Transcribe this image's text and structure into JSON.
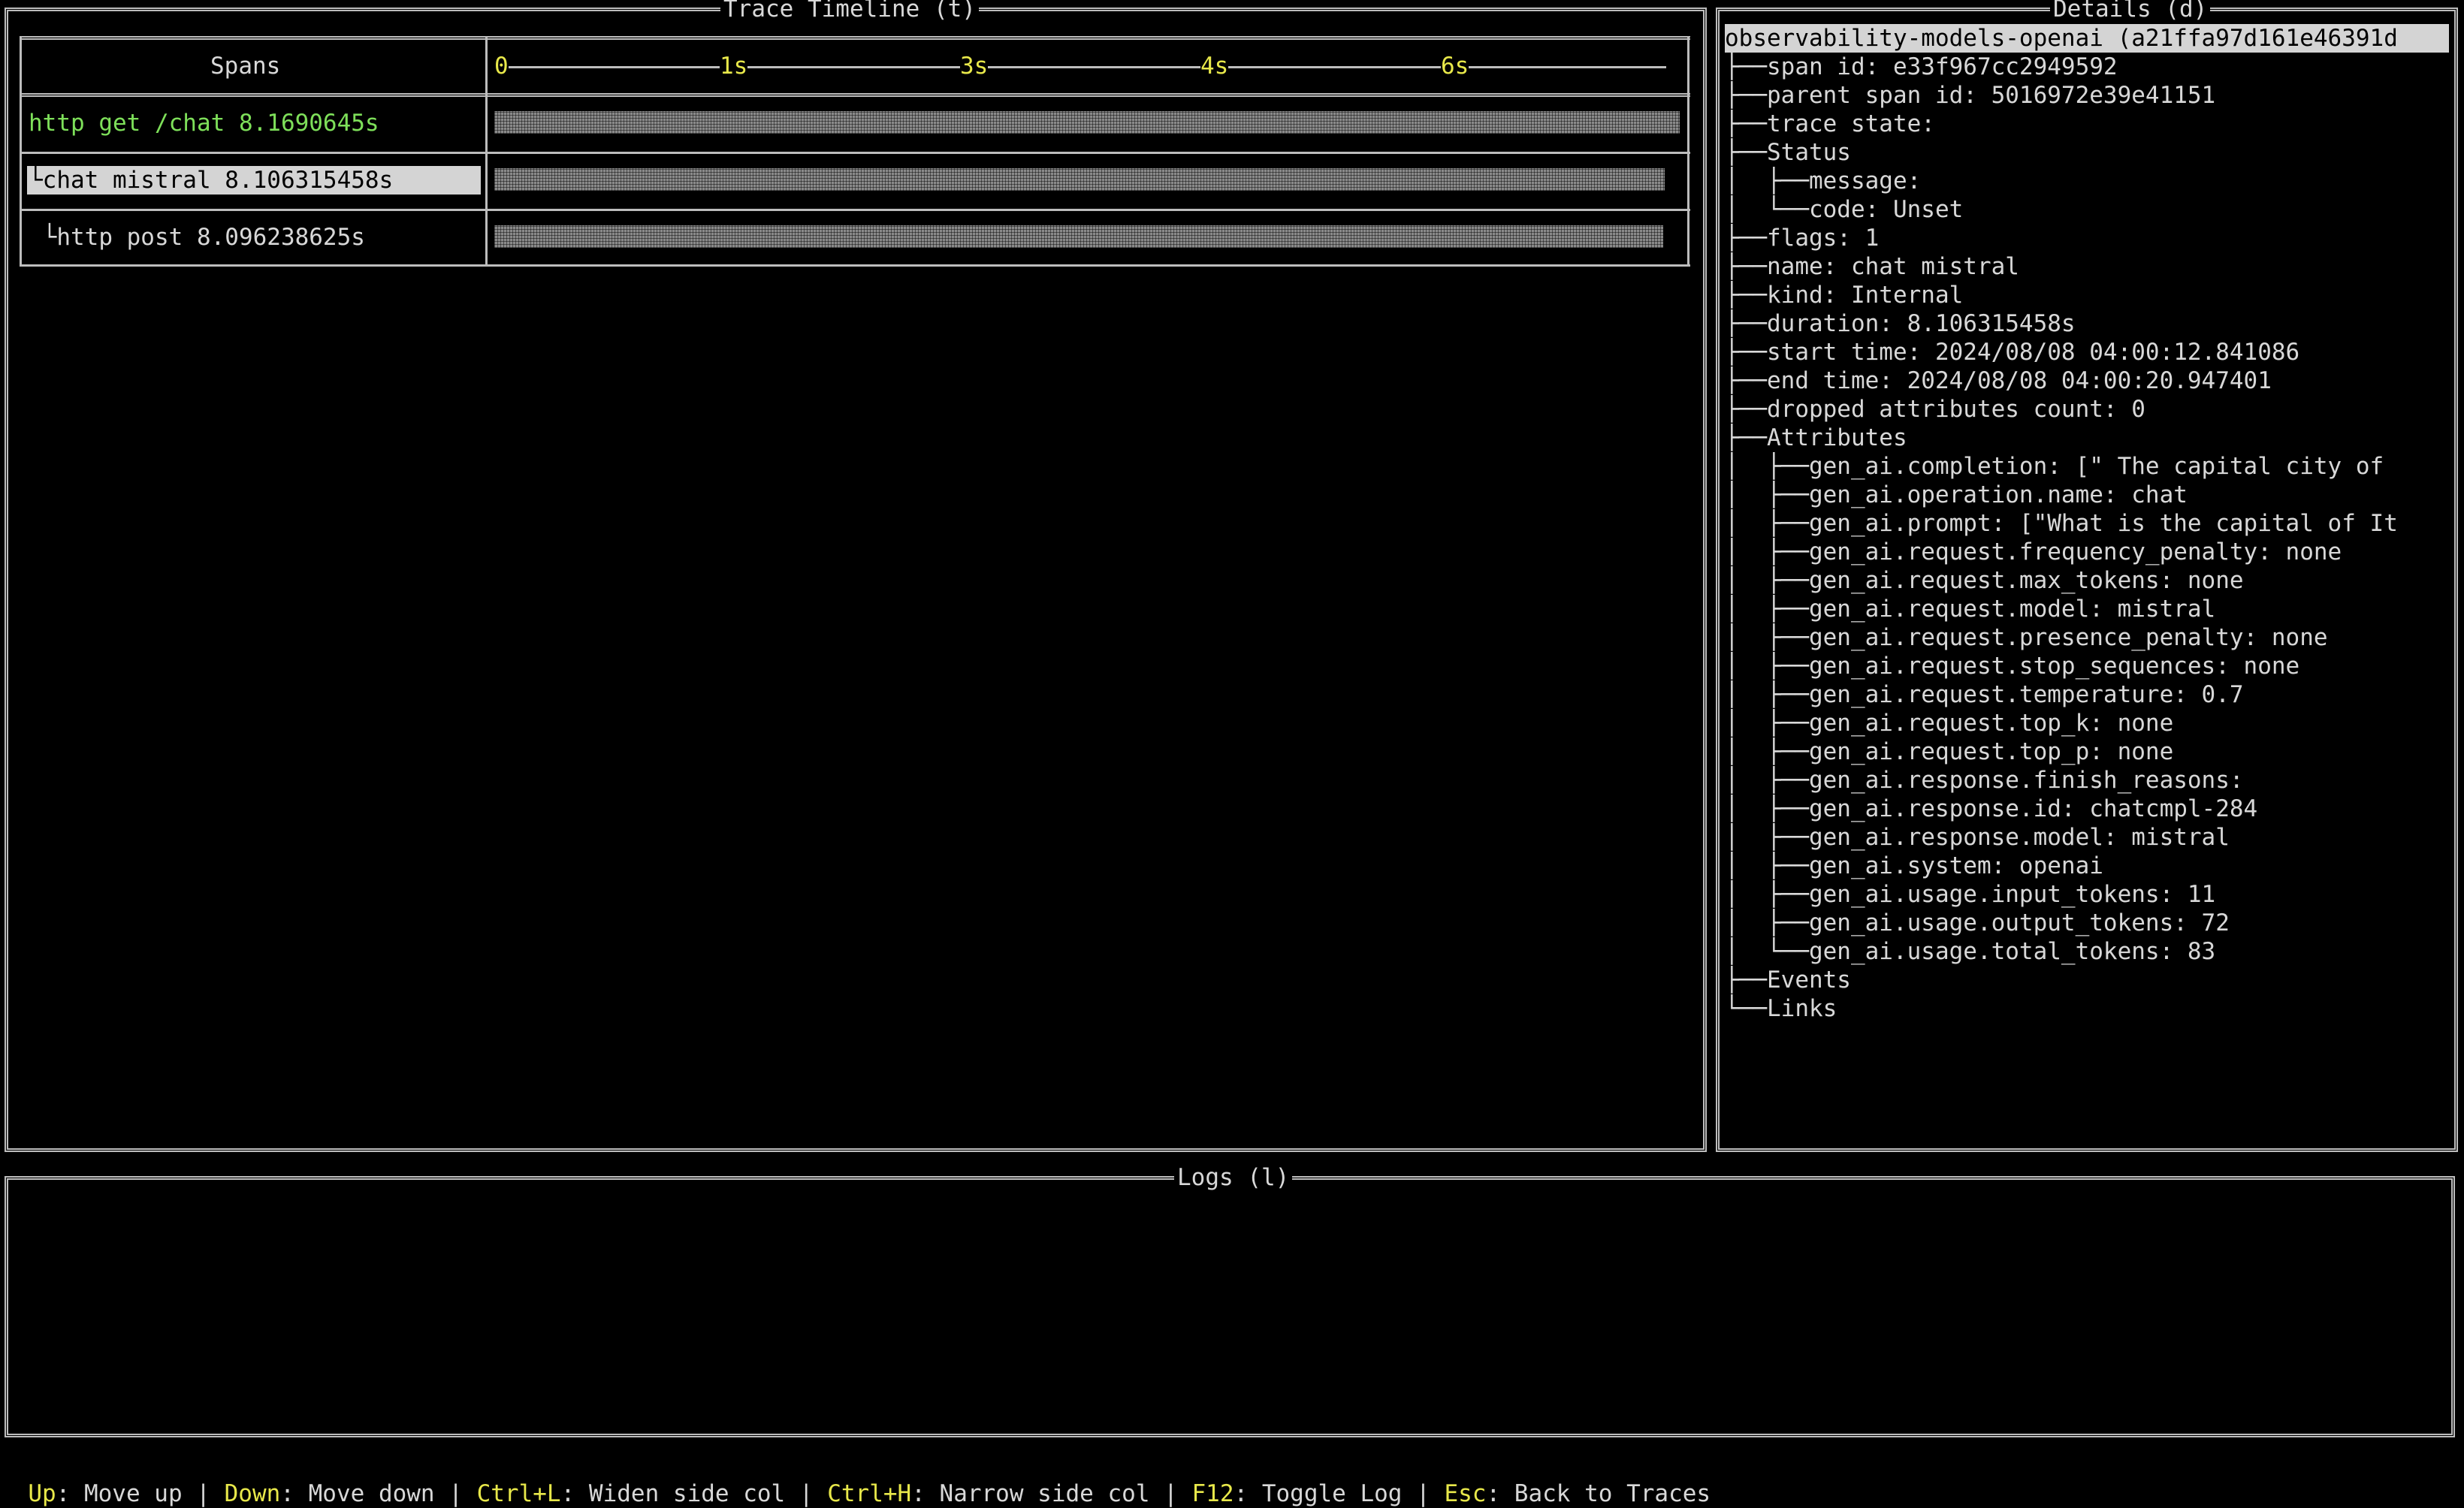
{
  "timeline": {
    "title": "Trace Timeline (t)",
    "spans_header": "Spans",
    "ticks": [
      "0",
      "1s",
      "3s",
      "4s",
      "6s"
    ],
    "spans": [
      {
        "label": "http get /chat 8.1690645s",
        "color": "#7ee05a",
        "selected": false,
        "start": 0.0,
        "duration": 8.1690645
      },
      {
        "label": "└chat mistral 8.106315458s",
        "color": "#000000",
        "selected": true,
        "start": 0.0,
        "duration": 8.106315458
      },
      {
        "label": " └http post 8.096238625s",
        "color": "#d8d8d8",
        "selected": false,
        "start": 0.0,
        "duration": 8.096238625
      }
    ]
  },
  "details": {
    "title": "Details (d)",
    "header": "observability-models-openai (a21ffa97d161e46391d",
    "lines": [
      "├──span id: e33f967cc2949592",
      "├──parent span id: 5016972e39e41151",
      "├──trace state:",
      "├──Status",
      "│  ├──message:",
      "│  └──code: Unset",
      "├──flags: 1",
      "├──name: chat mistral",
      "├──kind: Internal",
      "├──duration: 8.106315458s",
      "├──start time: 2024/08/08 04:00:12.841086",
      "├──end time: 2024/08/08 04:00:20.947401",
      "├──dropped attributes count: 0",
      "├──Attributes",
      "│  ├──gen_ai.completion: [\" The capital city of",
      "│  ├──gen_ai.operation.name: chat",
      "│  ├──gen_ai.prompt: [\"What is the capital of It",
      "│  ├──gen_ai.request.frequency_penalty: none",
      "│  ├──gen_ai.request.max_tokens: none",
      "│  ├──gen_ai.request.model: mistral",
      "│  ├──gen_ai.request.presence_penalty: none",
      "│  ├──gen_ai.request.stop_sequences: none",
      "│  ├──gen_ai.request.temperature: 0.7",
      "│  ├──gen_ai.request.top_k: none",
      "│  ├──gen_ai.request.top_p: none",
      "│  ├──gen_ai.response.finish_reasons:",
      "│  ├──gen_ai.response.id: chatcmpl-284",
      "│  ├──gen_ai.response.model: mistral",
      "│  ├──gen_ai.system: openai",
      "│  ├──gen_ai.usage.input_tokens: 11",
      "│  ├──gen_ai.usage.output_tokens: 72",
      "│  └──gen_ai.usage.total_tokens: 83",
      "├──Events",
      "└──Links"
    ]
  },
  "logs": {
    "title": "Logs (l)"
  },
  "statusbar": {
    "items": [
      {
        "key": "Up",
        "action": "Move up"
      },
      {
        "key": "Down",
        "action": "Move down"
      },
      {
        "key": "Ctrl+L",
        "action": "Widen side col"
      },
      {
        "key": "Ctrl+H",
        "action": "Narrow side col"
      },
      {
        "key": "F12",
        "action": "Toggle Log"
      },
      {
        "key": "Esc",
        "action": "Back to Traces"
      }
    ]
  },
  "colors": {
    "key": "#e8e84a",
    "border": "#bdbdbd",
    "span_root": "#7ee05a",
    "selection_bg": "#d4d4d4"
  }
}
